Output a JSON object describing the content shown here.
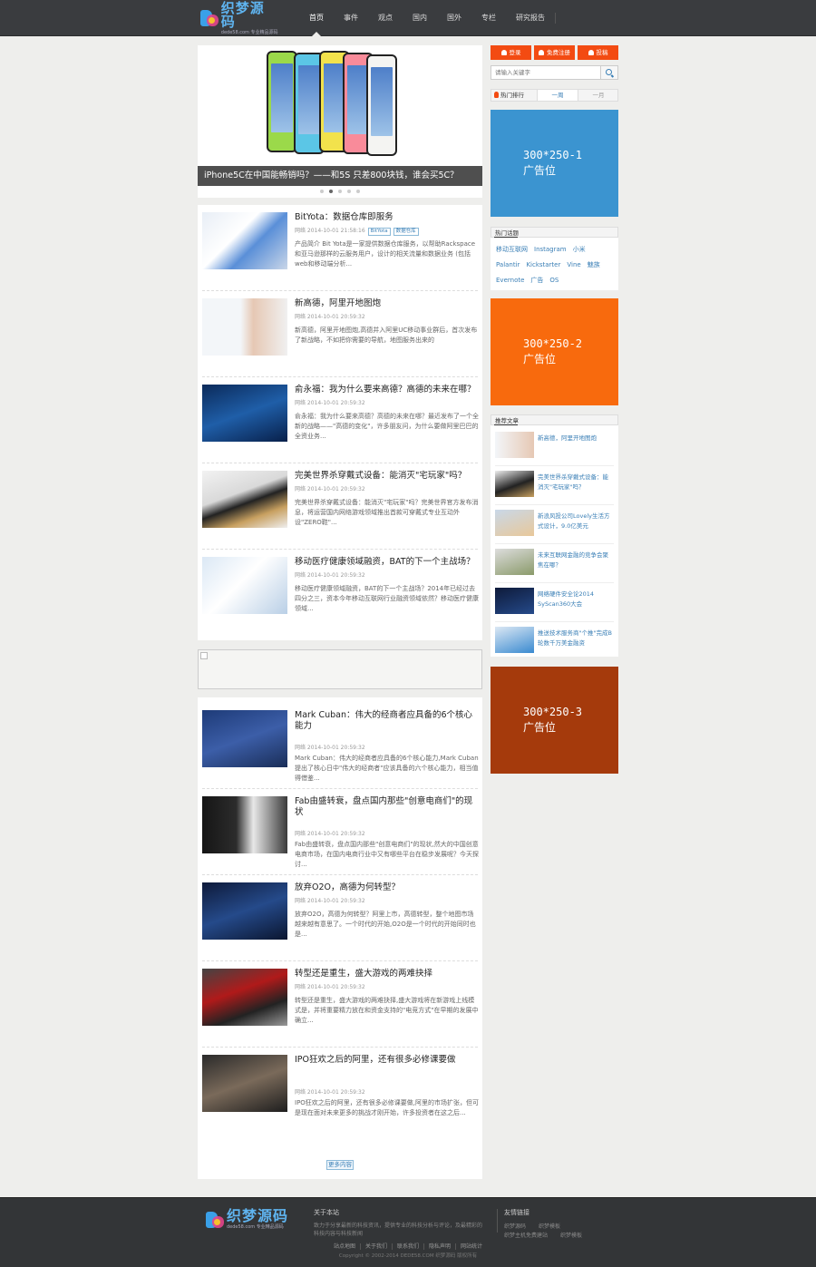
{
  "header": {
    "logo": {
      "main": "织梦源码",
      "sub": "dede58.com 专业精品源码"
    },
    "nav": [
      {
        "label": "首页",
        "active": true
      },
      {
        "label": "事件"
      },
      {
        "label": "观点"
      },
      {
        "label": "国内"
      },
      {
        "label": "国外"
      },
      {
        "label": "专栏"
      },
      {
        "label": "研究报告"
      }
    ]
  },
  "slider": {
    "caption": "iPhone5C在中国能畅销吗？——和5S 只差800块钱，谁会买5C？",
    "dots": 5,
    "active_dot": 1
  },
  "articles_top": [
    {
      "title": "BitYota：数据仓库即服务",
      "meta": "网络 2014-10-01 21:58:16",
      "tags": [
        "BitYota",
        "数据仓库"
      ],
      "summary": "产品简介 Bit Yota是一家提供数据仓库服务，以帮助Rackspace和亚马逊那样的云服务用户，设计的相关流量和数据业务 (包括web和移动端分析..."
    },
    {
      "title": "新高德，阿里开地图炮",
      "meta": "网络 2014-10-01 20:59:32",
      "summary": "新高德，阿里开地图炮,高德并入阿里UC移动事业群后，首次发布了新战略，不如把你需要的导航，地图服务出来的"
    },
    {
      "title": "俞永福：我为什么要来高德？高德的未来在哪？",
      "meta": "网络 2014-10-01 20:59:32",
      "summary": "俞永福：我为什么要来高德？高德的未来在哪？最近发布了一个全新的战略——\"高德的变化\"，许多朋友问，为什么要做阿里巴巴的全资业务..."
    },
    {
      "title": "完美世界杀穿戴式设备：能消灭\"宅玩家\"吗？",
      "meta": "网络 2014-10-01 20:59:32",
      "summary": "完美世界杀穿戴式设备：能消灭\"宅玩家\"吗？完美世界官方发布消息，将运营国内网络游戏领域推出首款可穿戴式专业互动外设\"ZERO鞋\"..."
    },
    {
      "title": "移动医疗健康领域融资，BAT的下一个主战场？",
      "meta": "网络 2014-10-01 20:59:32",
      "summary": "移动医疗健康领域融资，BAT的下一个主战场？2014年已经过去四分之三，资本今年移动互联网行业融资领域依然？移动医疗健康领域..."
    }
  ],
  "articles_bottom": [
    {
      "title": "Mark Cuban：伟大的经商者应具备的6个核心能力",
      "meta": "网络 2014-10-01 20:59:32",
      "summary": "Mark Cuban：伟大的经商者应具备的6个核心能力,Mark Cuban提出了核心日中\"伟大的经商者\"应该具备的六个核心能力，相当值得借鉴..."
    },
    {
      "title": "Fab由盛转衰，盘点国内那些\"创意电商们\"的现状",
      "meta": "网络 2014-10-01 20:59:32",
      "summary": "Fab由盛转衰，盘点国内那些\"创意电商们\"的现状,然大的中国创意电商市场，在国内电商行业中又有哪些平台在稳步发展呢？今天探讨..."
    },
    {
      "title": "放弃O2O，高德为何转型？",
      "meta": "网络 2014-10-01 20:59:32",
      "summary": "放弃O2O，高德为何转型？阿里上市，高德转型，整个地图市场越来越有意思了。一个时代的开始,O2O是一个时代的开始同时也是..."
    },
    {
      "title": "转型还是重生，盛大游戏的两难抉择",
      "meta": "网络 2014-10-01 20:59:32",
      "summary": "转型还是重生，盛大游戏的两难抉择,盛大游戏将在新游戏上线模式是，并将重要精力放在和资金支持的\"电竞方式\"在早期的发展中确立..."
    },
    {
      "title": "IPO狂欢之后的阿里，还有很多必修课要做",
      "meta": "网络 2014-10-01 20:59:32",
      "summary": "IPO狂欢之后的阿里，还有很多必修课要做,阿里的市场扩张，但可是现在面对未来更多的挑战才刚开始，许多投资者在这之后..."
    }
  ],
  "more_label": "更多内容",
  "sidebar": {
    "user_buttons": [
      "登录",
      "免费注册",
      "投稿"
    ],
    "search_placeholder": "请输入关键字",
    "hot_title": "热门排行",
    "hot_tabs": [
      "一周",
      "一月"
    ],
    "ads": [
      "300*250-1",
      "300*250-2",
      "300*250-3"
    ],
    "ad_label": "广告位",
    "ad_colors": [
      "#3b94d0",
      "#f86a0d",
      "#a53a0c"
    ],
    "tags_title": "热门话题",
    "tags": [
      "移动互联网",
      "Instagram",
      "小米",
      "Palantir",
      "Kickstarter",
      "Vine",
      "魅族",
      "Evernote",
      "广告",
      "OS"
    ],
    "rec_title": "推荐文章",
    "rec_items": [
      "新高德，阿里开地图炮",
      "完美世界杀穿戴式设备：能消灭\"宅玩家\"吗？",
      "新浪风投公司Lovely生活方式设计，9.0亿美元",
      "未来互联网金融的竞争会聚焦在哪？",
      "网络硬件安全论2014 SyScan360大会",
      "推送技术服务商\"个推\"完成B轮数千万美金融资"
    ]
  },
  "footer": {
    "logo": {
      "main": "织梦源码",
      "sub": "dede58.com 专业精品源码"
    },
    "about_title": "关于本站",
    "about_text": "致力于分享最新的科技资讯，提供专业的科技分析与评论，及最精彩的科技内容与科技新闻",
    "links_title": "友情链接",
    "links": [
      "织梦源码",
      "织梦模板",
      "织梦主机免费建站",
      "织梦模板"
    ],
    "bottom_links": [
      "站点地图",
      "关于我们",
      "联系我们",
      "隐私声明",
      "网站统计"
    ],
    "copyright": "Copyright © 2002-2014 DEDE58.COM 织梦源码 版权所有"
  }
}
